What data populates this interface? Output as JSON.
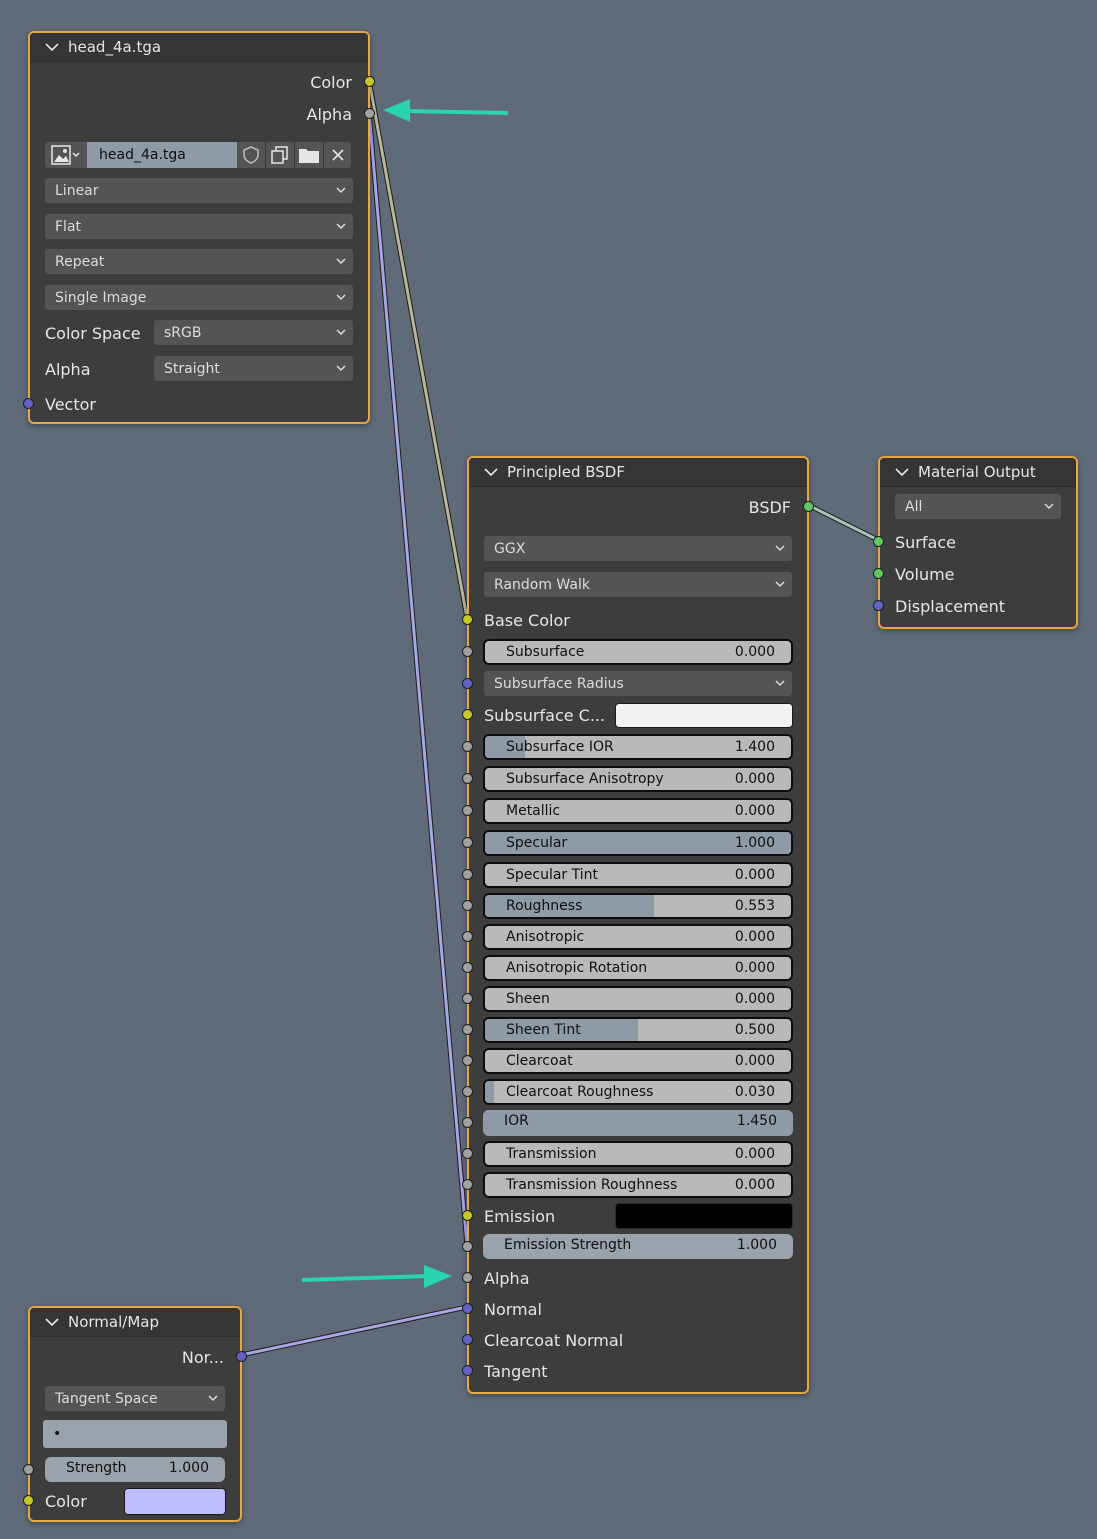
{
  "image_node": {
    "title": "head_4a.tga",
    "outputs": {
      "color": "Color",
      "alpha": "Alpha"
    },
    "image_name": "head_4a.tga",
    "interpolation": "Linear",
    "projection": "Flat",
    "extension": "Repeat",
    "source": "Single Image",
    "color_space_label": "Color Space",
    "color_space": "sRGB",
    "alpha_label": "Alpha",
    "alpha_mode": "Straight",
    "vector_label": "Vector"
  },
  "bsdf_node": {
    "title": "Principled BSDF",
    "output": "BSDF",
    "distribution": "GGX",
    "subsurface_method": "Random Walk",
    "base_color": "Base Color",
    "subsurface_radius": "Subsurface Radius",
    "subsurface_color": "Subsurface C...",
    "sliders": [
      {
        "label": "Subsurface",
        "value": "0.000",
        "fraction": 0
      },
      {
        "label": "Subsurface IOR",
        "value": "1.400",
        "fraction": 0.13
      },
      {
        "label": "Subsurface Anisotropy",
        "value": "0.000",
        "fraction": 0
      },
      {
        "label": "Metallic",
        "value": "0.000",
        "fraction": 0
      },
      {
        "label": "Specular",
        "value": "1.000",
        "fraction": 1
      },
      {
        "label": "Specular Tint",
        "value": "0.000",
        "fraction": 0
      },
      {
        "label": "Roughness",
        "value": "0.553",
        "fraction": 0.553
      },
      {
        "label": "Anisotropic",
        "value": "0.000",
        "fraction": 0
      },
      {
        "label": "Anisotropic Rotation",
        "value": "0.000",
        "fraction": 0
      },
      {
        "label": "Sheen",
        "value": "0.000",
        "fraction": 0
      },
      {
        "label": "Sheen Tint",
        "value": "0.500",
        "fraction": 0.5
      },
      {
        "label": "Clearcoat",
        "value": "0.000",
        "fraction": 0
      },
      {
        "label": "Clearcoat Roughness",
        "value": "0.030",
        "fraction": 0.03
      },
      {
        "label": "IOR",
        "value": "1.450",
        "fraction": 1
      },
      {
        "label": "Transmission",
        "value": "0.000",
        "fraction": 0
      },
      {
        "label": "Transmission Roughness",
        "value": "0.000",
        "fraction": 0
      }
    ],
    "emission": "Emission",
    "emission_strength": {
      "label": "Emission Strength",
      "value": "1.000"
    },
    "alpha": "Alpha",
    "normal": "Normal",
    "clearcoat_normal": "Clearcoat Normal",
    "tangent": "Tangent"
  },
  "output_node": {
    "title": "Material Output",
    "target": "All",
    "surface": "Surface",
    "volume": "Volume",
    "displacement": "Displacement"
  },
  "normal_node": {
    "title": "Normal/Map",
    "output": "Nor...",
    "space": "Tangent Space",
    "uv_map": "•",
    "strength_label": "Strength",
    "strength_value": "1.000",
    "color_label": "Color"
  },
  "colors": {
    "node_border": "#e9a443",
    "background": "#5f6b78",
    "arrow": "#2ad4b0",
    "normal_color": "#bdbdff",
    "subsurface_color": "#f2f2f2",
    "emission_color": "#000000"
  }
}
